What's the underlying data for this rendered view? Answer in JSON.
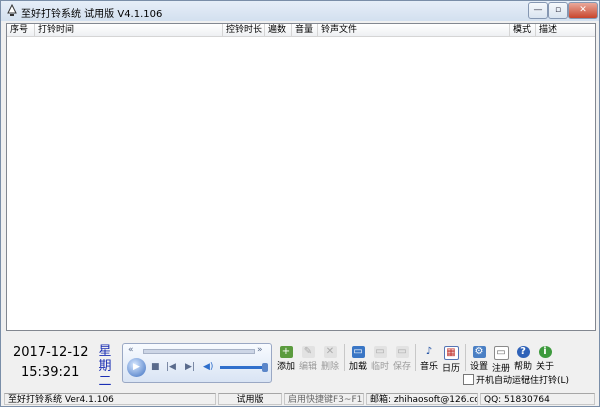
{
  "window": {
    "title": "至好打铃系统 试用版 V4.1.106",
    "controls": {
      "minimize": "—",
      "restore": "▫",
      "close": "✕"
    }
  },
  "list": {
    "columns": [
      "序号",
      "打铃时间",
      "控铃时长",
      "遍数",
      "音量",
      "铃声文件",
      "模式",
      "描述"
    ],
    "rows": []
  },
  "clock": {
    "date": "2017-12-12",
    "time": "15:39:21",
    "weekday": [
      "星",
      "期",
      "二"
    ]
  },
  "player": {
    "prev_icon": "«",
    "next_icon": "»",
    "play_icon": "▶",
    "stop_icon": "■",
    "back_icon": "|◀",
    "fwd_icon": "▶|",
    "vol_icon": "◀)",
    "volume_fraction": 0.95
  },
  "toolbar": {
    "buttons": [
      {
        "key": "add",
        "label": "添加",
        "icon": "+"
      },
      {
        "key": "edit",
        "label": "编辑",
        "icon": "✎"
      },
      {
        "key": "delete",
        "label": "删除",
        "icon": "✕"
      },
      {
        "key": "load",
        "label": "加载",
        "icon": "▭"
      },
      {
        "key": "temp",
        "label": "临时",
        "icon": "▭"
      },
      {
        "key": "save",
        "label": "保存",
        "icon": "▭"
      },
      {
        "key": "music",
        "label": "音乐",
        "icon": "♪"
      },
      {
        "key": "calendar",
        "label": "日历",
        "icon": "▦"
      },
      {
        "key": "settings",
        "label": "设置",
        "icon": "⚙"
      },
      {
        "key": "register",
        "label": "注册",
        "icon": "▭"
      },
      {
        "key": "help",
        "label": "帮助",
        "icon": "?"
      },
      {
        "key": "about",
        "label": "关于",
        "icon": "i"
      }
    ]
  },
  "options": {
    "auto_start_label": "开机自动运行",
    "remember_label": "记住打铃(L)"
  },
  "status": {
    "version": "至好打铃系统 Ver4.1.106",
    "edition": "试用版",
    "shortcut": "启用快捷键F3~F12",
    "email": "邮箱: zhihaosoft@126.com",
    "qq": "QQ: 51830764"
  },
  "colors": {
    "weekday": "#1b2fb4",
    "border": "#828790"
  }
}
